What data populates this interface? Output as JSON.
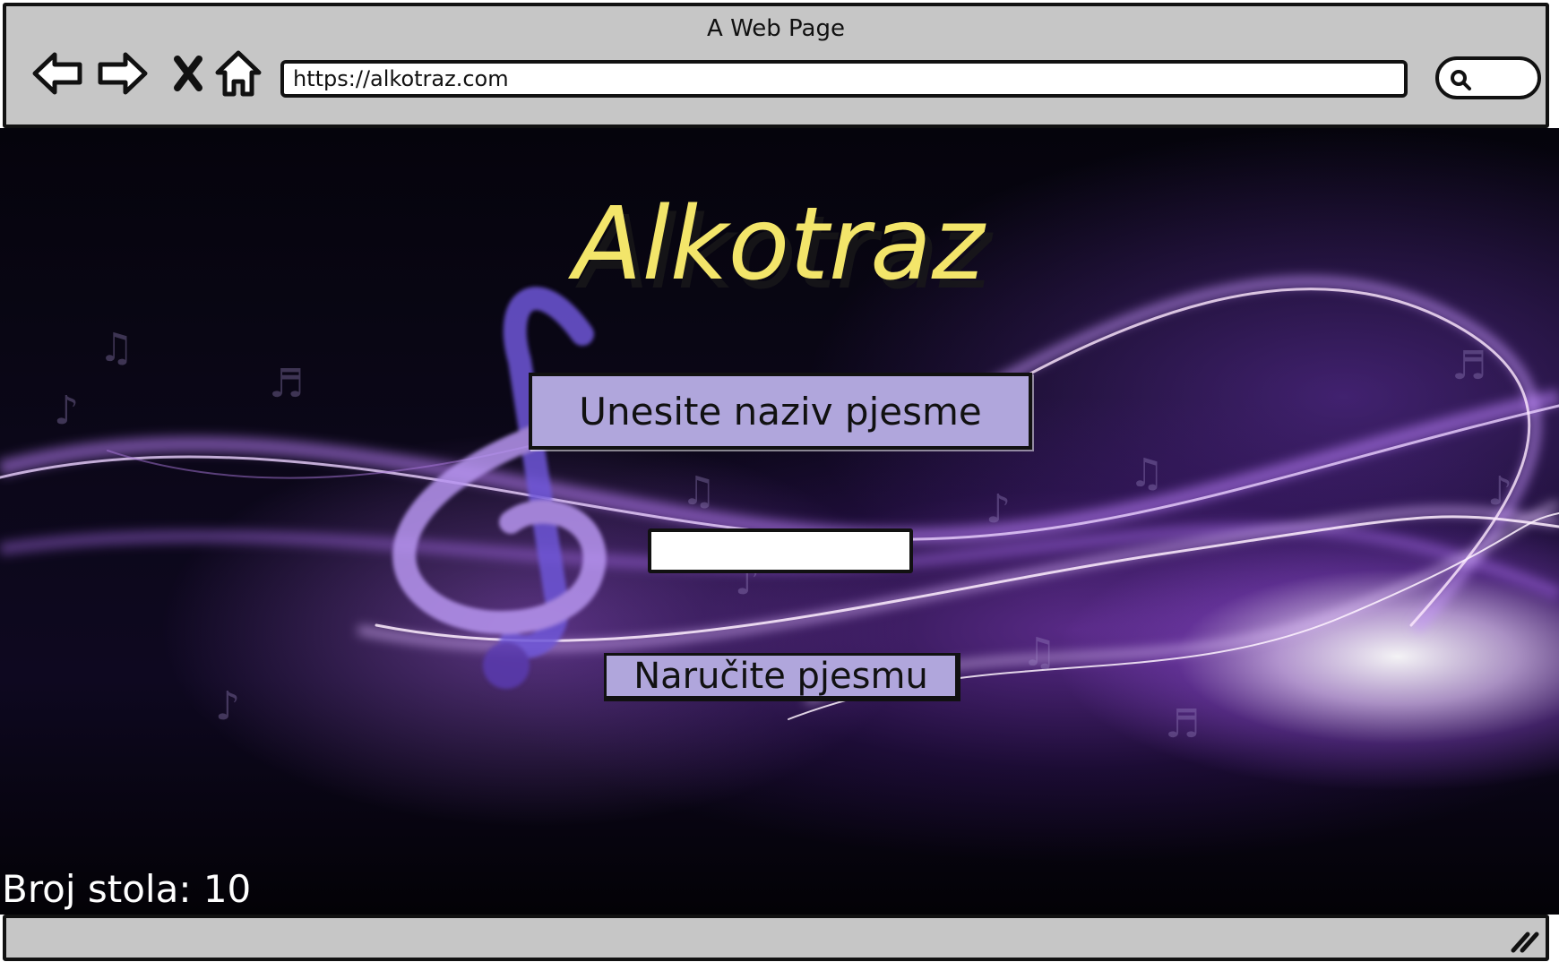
{
  "window": {
    "title": "A Web Page"
  },
  "toolbar": {
    "url": "https://alkotraz.com",
    "icons": [
      "back-arrow-icon",
      "forward-arrow-icon",
      "close-icon",
      "home-icon",
      "search-icon"
    ]
  },
  "page": {
    "logo_text": "Alkotraz",
    "song_prompt": "Unesite naziv pjesme",
    "song_input_value": "",
    "order_button_label": "Naručite pjesmu",
    "table_number": "Broj stola: 10"
  },
  "colors": {
    "chrome": "#c6c6c6",
    "button_fill": "#b0a6dc",
    "logo_yellow": "#f3e56a",
    "background_dark": "#0b0718",
    "glow_purple": "#9a5ae0"
  }
}
